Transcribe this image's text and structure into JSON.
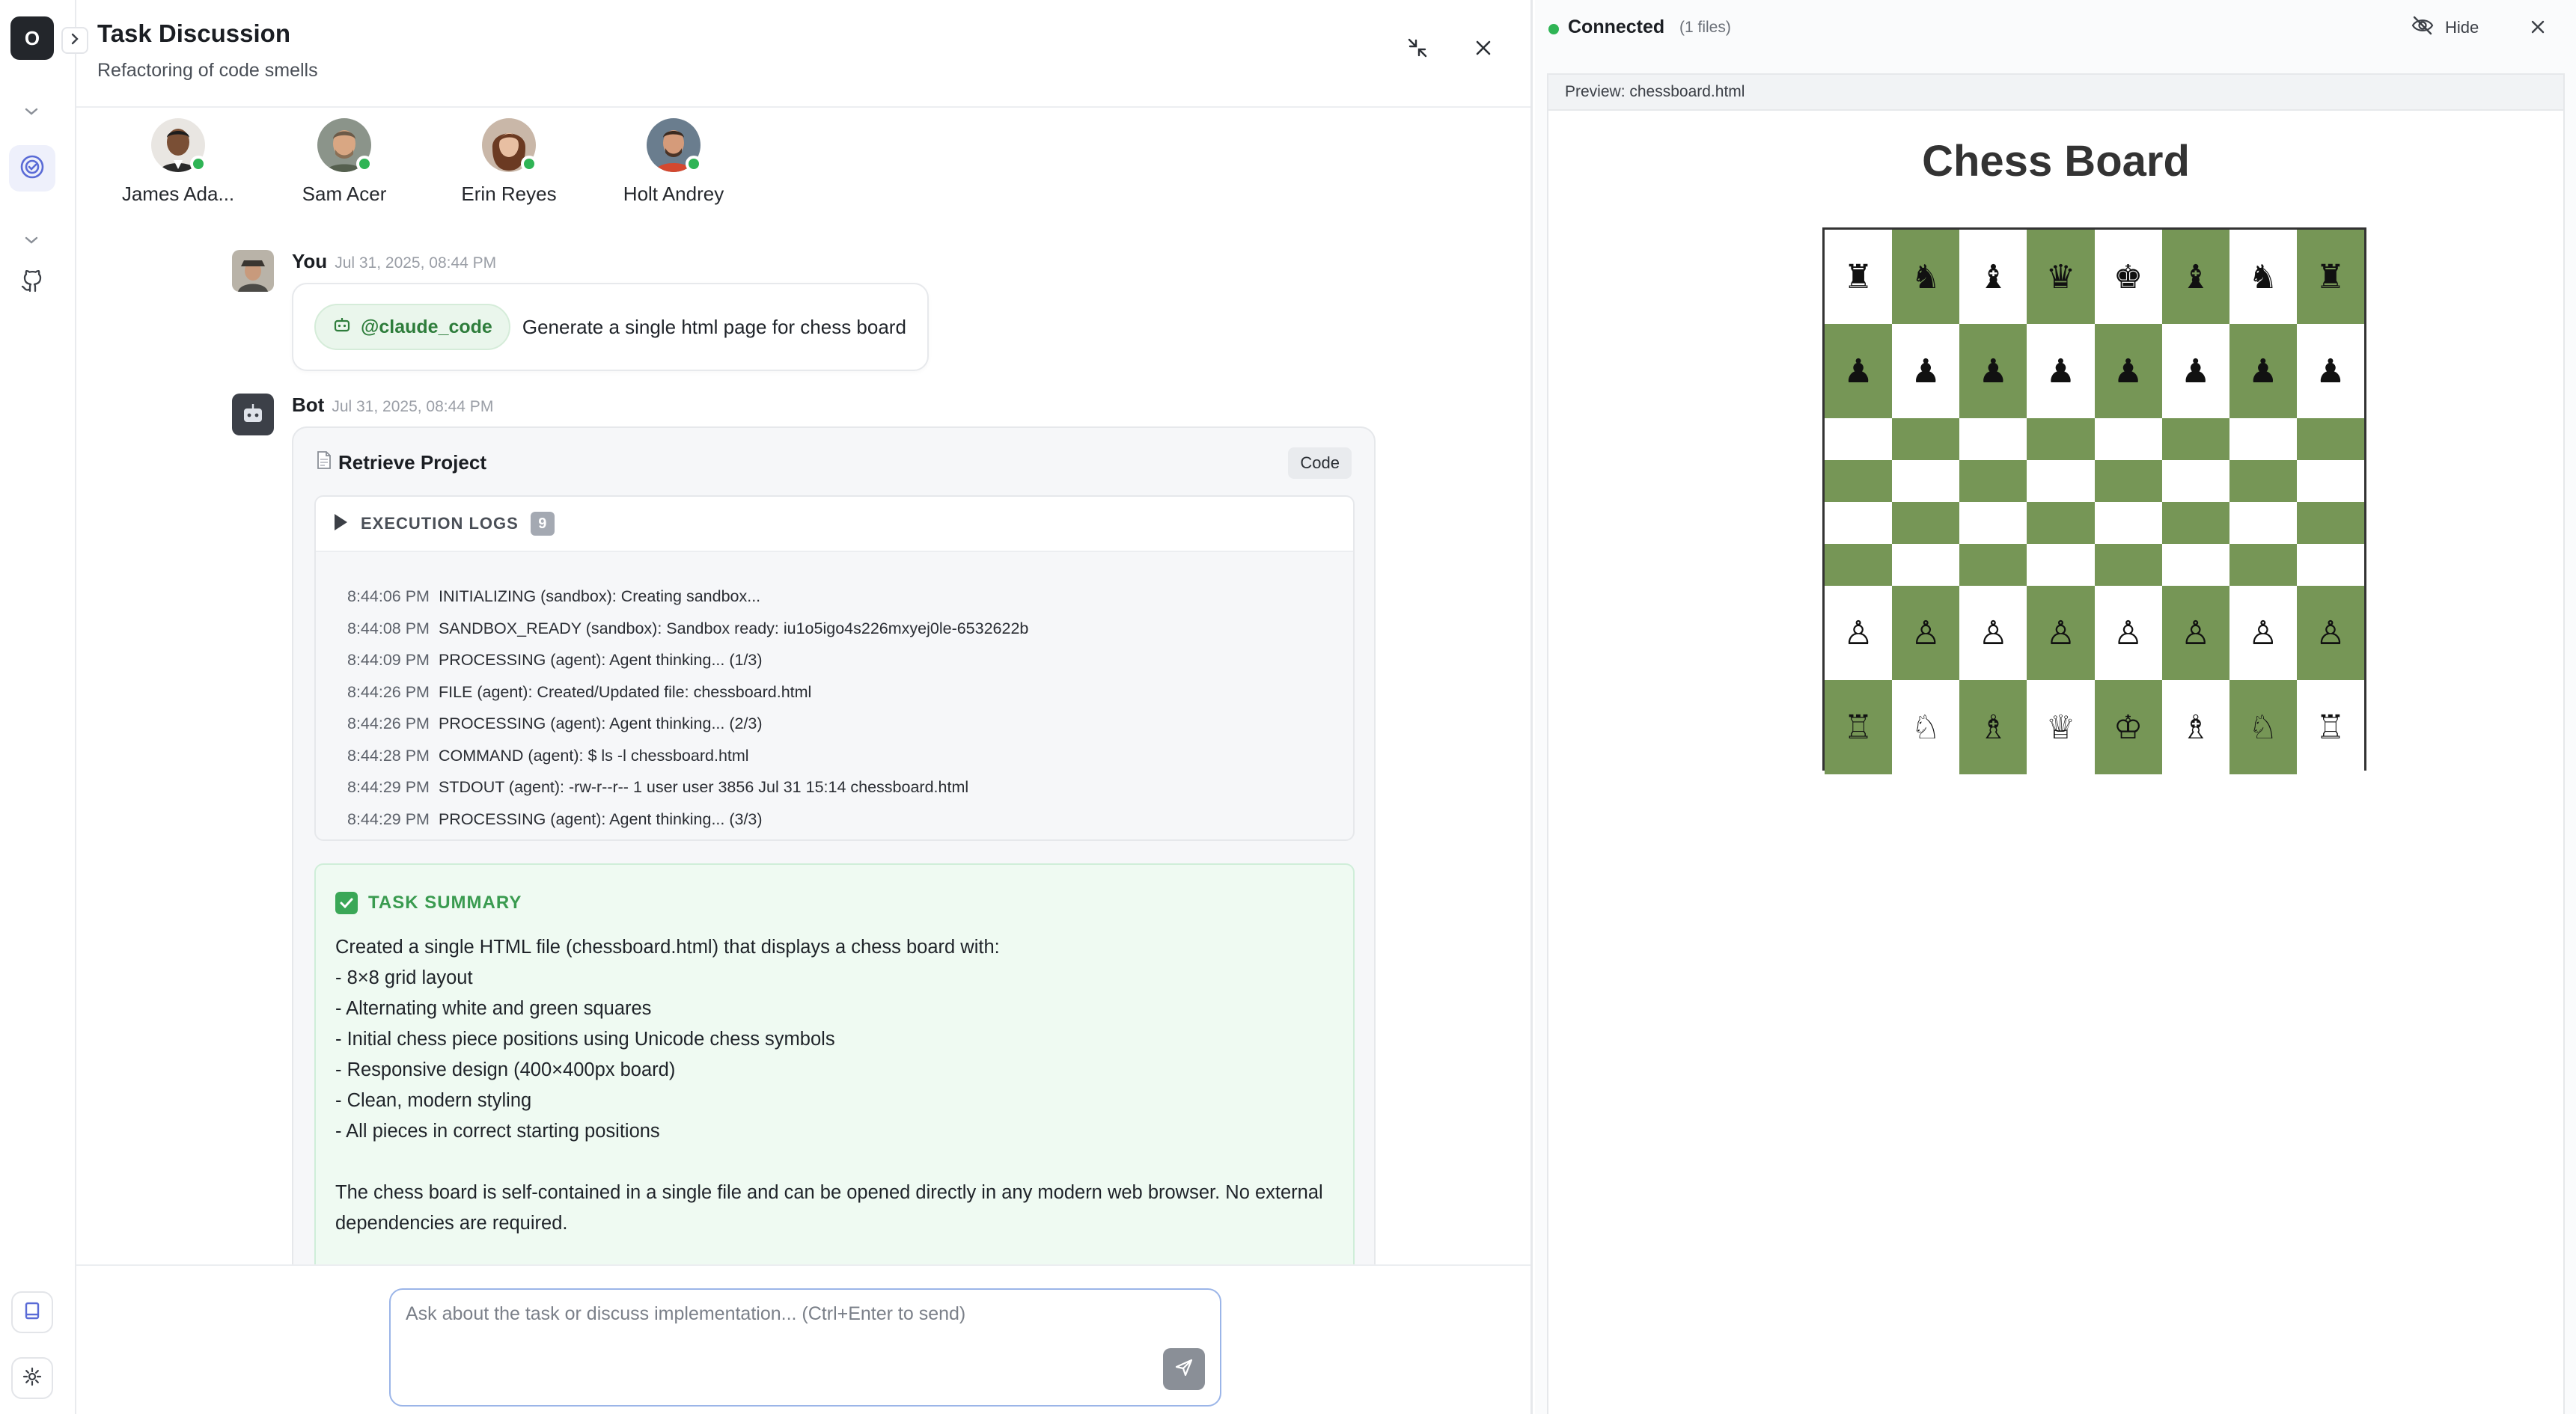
{
  "rail": {
    "logo_letter": "O"
  },
  "chat": {
    "title": "Task Discussion",
    "subtitle": "Refactoring of code smells",
    "participants": [
      {
        "name": "James Ada...",
        "online": true
      },
      {
        "name": "Sam Acer",
        "online": true
      },
      {
        "name": "Erin Reyes",
        "online": true
      },
      {
        "name": "Holt Andrey",
        "online": true
      }
    ],
    "messages": {
      "user": {
        "author": "You",
        "time": "Jul 31, 2025, 08:44 PM",
        "mention": "@claude_code",
        "text": "Generate a single html page for chess board"
      },
      "bot": {
        "author": "Bot",
        "time": "Jul 31, 2025, 08:44 PM",
        "card_title": "Retrieve Project",
        "code_label": "Code",
        "logs_title": "EXECUTION LOGS",
        "logs_count": "9",
        "logs": [
          {
            "time": "8:44:06 PM",
            "text": "INITIALIZING (sandbox): Creating sandbox..."
          },
          {
            "time": "8:44:08 PM",
            "text": "SANDBOX_READY (sandbox): Sandbox ready: iu1o5igo4s226mxyej0le-6532622b"
          },
          {
            "time": "8:44:09 PM",
            "text": "PROCESSING (agent): Agent thinking... (1/3)"
          },
          {
            "time": "8:44:26 PM",
            "text": "FILE (agent): Created/Updated file: chessboard.html"
          },
          {
            "time": "8:44:26 PM",
            "text": "PROCESSING (agent): Agent thinking... (2/3)"
          },
          {
            "time": "8:44:28 PM",
            "text": "COMMAND (agent): $ ls -l chessboard.html"
          },
          {
            "time": "8:44:29 PM",
            "text": "STDOUT (agent): -rw-r--r-- 1 user user 3856 Jul 31 15:14 chessboard.html"
          },
          {
            "time": "8:44:29 PM",
            "text": "PROCESSING (agent): Agent thinking... (3/3)"
          }
        ],
        "summary_title": "TASK SUMMARY",
        "summary_intro": "Created a single HTML file (chessboard.html) that displays a chess board with:",
        "summary_items": [
          "- 8×8 grid layout",
          "- Alternating white and green squares",
          "- Initial chess piece positions using Unicode chess symbols",
          "- Responsive design (400×400px board)",
          "- Clean, modern styling",
          "- All pieces in correct starting positions"
        ],
        "summary_outro": "The chess board is self-contained in a single file and can be opened directly in any modern web browser. No external dependencies are required."
      }
    },
    "composer_placeholder": "Ask about the task or discuss implementation... (Ctrl+Enter to send)"
  },
  "preview": {
    "status": "Connected",
    "files_count": "(1 files)",
    "hide_label": "Hide",
    "preview_label": "Preview: chessboard.html",
    "board_title": "Chess Board",
    "board_colors": {
      "light": "#ffffff",
      "dark": "#769656"
    },
    "board_rows": [
      [
        "♜",
        "♞",
        "♝",
        "♛",
        "♚",
        "♝",
        "♞",
        "♜"
      ],
      [
        "♟",
        "♟",
        "♟",
        "♟",
        "♟",
        "♟",
        "♟",
        "♟"
      ],
      [
        "",
        "",
        "",
        "",
        "",
        "",
        "",
        ""
      ],
      [
        "",
        "",
        "",
        "",
        "",
        "",
        "",
        ""
      ],
      [
        "",
        "",
        "",
        "",
        "",
        "",
        "",
        ""
      ],
      [
        "",
        "",
        "",
        "",
        "",
        "",
        "",
        ""
      ],
      [
        "♙",
        "♙",
        "♙",
        "♙",
        "♙",
        "♙",
        "♙",
        "♙"
      ],
      [
        "♖",
        "♘",
        "♗",
        "♕",
        "♔",
        "♗",
        "♘",
        "♖"
      ]
    ]
  },
  "colors": {
    "online": "#2fb455",
    "accent_green": "#3a9b50",
    "composer_border": "#9bb5e8"
  }
}
